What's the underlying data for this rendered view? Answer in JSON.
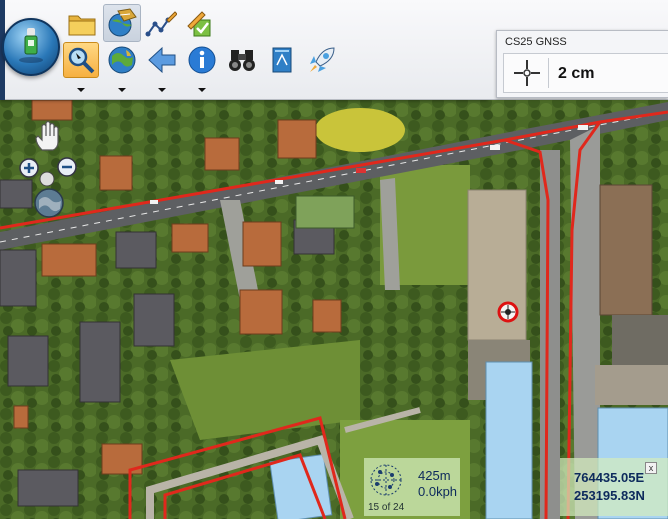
{
  "app": {
    "toolbar": {
      "row1": [
        "open-folder-icon",
        "layers-globe-icon",
        "draw-polyline-icon",
        "edit-check-icon"
      ],
      "row2": [
        "zoom-tool-icon",
        "globe-icon",
        "back-arrow-icon",
        "info-icon",
        "binoculars-icon",
        "bookmark-icon",
        "rocket-icon"
      ],
      "active_tool": "zoom-tool-icon"
    },
    "accent_color": "#f6b041"
  },
  "gnss": {
    "title": "CS25 GNSS",
    "accuracy": "2 cm",
    "icon": "crosshair-icon"
  },
  "map_tools": [
    "pan-hand-icon",
    "zoom-in-icon",
    "zoom-out-icon",
    "globe-icon"
  ],
  "status": {
    "distance": "425m",
    "speed": "0.0kph",
    "page": "15 of 24",
    "easting": "764435.05E",
    "northing": "253195.83N",
    "close_label": "x"
  }
}
